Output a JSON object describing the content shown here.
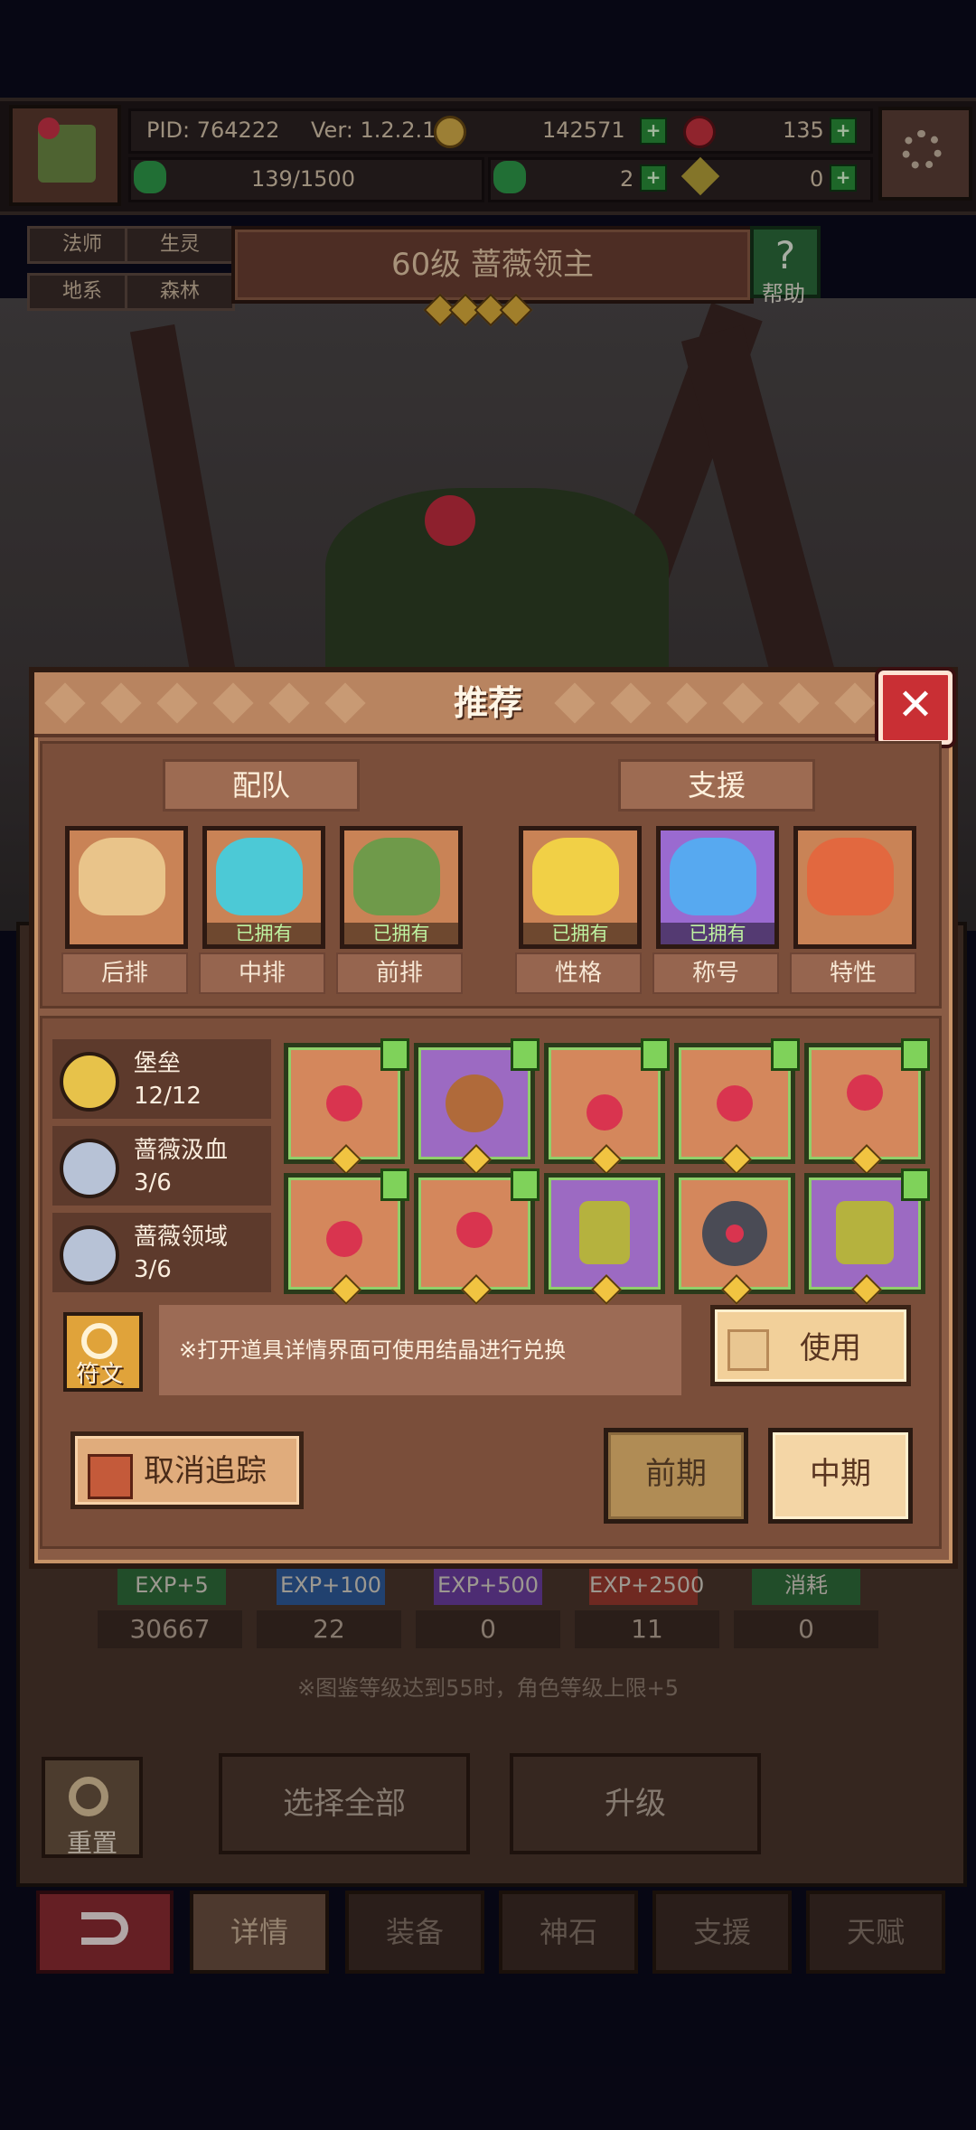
{
  "header": {
    "pid": "PID: 764222",
    "version": "Ver: 1.2.2.1",
    "gold": "142571",
    "gems": "135",
    "stamina": "139/1500",
    "clover": "2",
    "keys": "0"
  },
  "tags": [
    "法师",
    "生灵",
    "地系",
    "森林"
  ],
  "hero_title": "60级 蔷薇领主",
  "help_label": "帮助",
  "stars": 4,
  "underlying": {
    "exp_labels": [
      "EXP+5",
      "EXP+100",
      "EXP+500",
      "EXP+2500",
      "消耗"
    ],
    "counts": [
      "30667",
      "22",
      "0",
      "11",
      "0"
    ],
    "note": "※图鉴等级达到55时，角色等级上限+5",
    "select_all": "选择全部",
    "upgrade": "升级",
    "reset": "重置",
    "nav": [
      "详情",
      "装备",
      "神石",
      "支援",
      "天赋"
    ]
  },
  "modal": {
    "title": "推荐",
    "team_label": "配队",
    "support_label": "支援",
    "team": [
      {
        "label": "后排",
        "owned": "",
        "color": "#e9c48a"
      },
      {
        "label": "中排",
        "owned": "已拥有",
        "color": "#4cc9d6"
      },
      {
        "label": "前排",
        "owned": "已拥有",
        "color": "#6f9a4a"
      }
    ],
    "support": [
      {
        "label": "性格",
        "owned": "已拥有",
        "color": "#f1d046"
      },
      {
        "label": "称号",
        "owned": "已拥有",
        "color": "#57a9f0"
      },
      {
        "label": "特性",
        "owned": "",
        "color": "#e2683f"
      }
    ],
    "sets": [
      {
        "name": "堡垒",
        "count": "12/12",
        "color": "#e7c24a"
      },
      {
        "name": "蔷薇汲血",
        "count": "3/6",
        "color": "#b7c2d6"
      },
      {
        "name": "蔷薇领域",
        "count": "3/6",
        "color": "#b7c2d6"
      }
    ],
    "items": [
      {
        "type": "orange",
        "gem": "#d9344f"
      },
      {
        "type": "purple",
        "gem": "#b06a3a"
      },
      {
        "type": "orange",
        "gem": "#d9344f"
      },
      {
        "type": "orange",
        "gem": "#d9344f"
      },
      {
        "type": "orange",
        "gem": "#d9344f"
      },
      {
        "type": "orange",
        "gem": "#d9344f"
      },
      {
        "type": "orange",
        "gem": "#d9344f"
      },
      {
        "type": "purple",
        "gem": "#b5b23e"
      },
      {
        "type": "orange",
        "gem": "#d9344f"
      },
      {
        "type": "purple",
        "gem": "#b5b23e"
      }
    ],
    "rune_label": "符文",
    "hint": "※打开道具详情界面可使用结晶进行兑换",
    "use_label": "使用",
    "untrack_label": "取消追踪",
    "phase_early": "前期",
    "phase_mid": "中期"
  }
}
